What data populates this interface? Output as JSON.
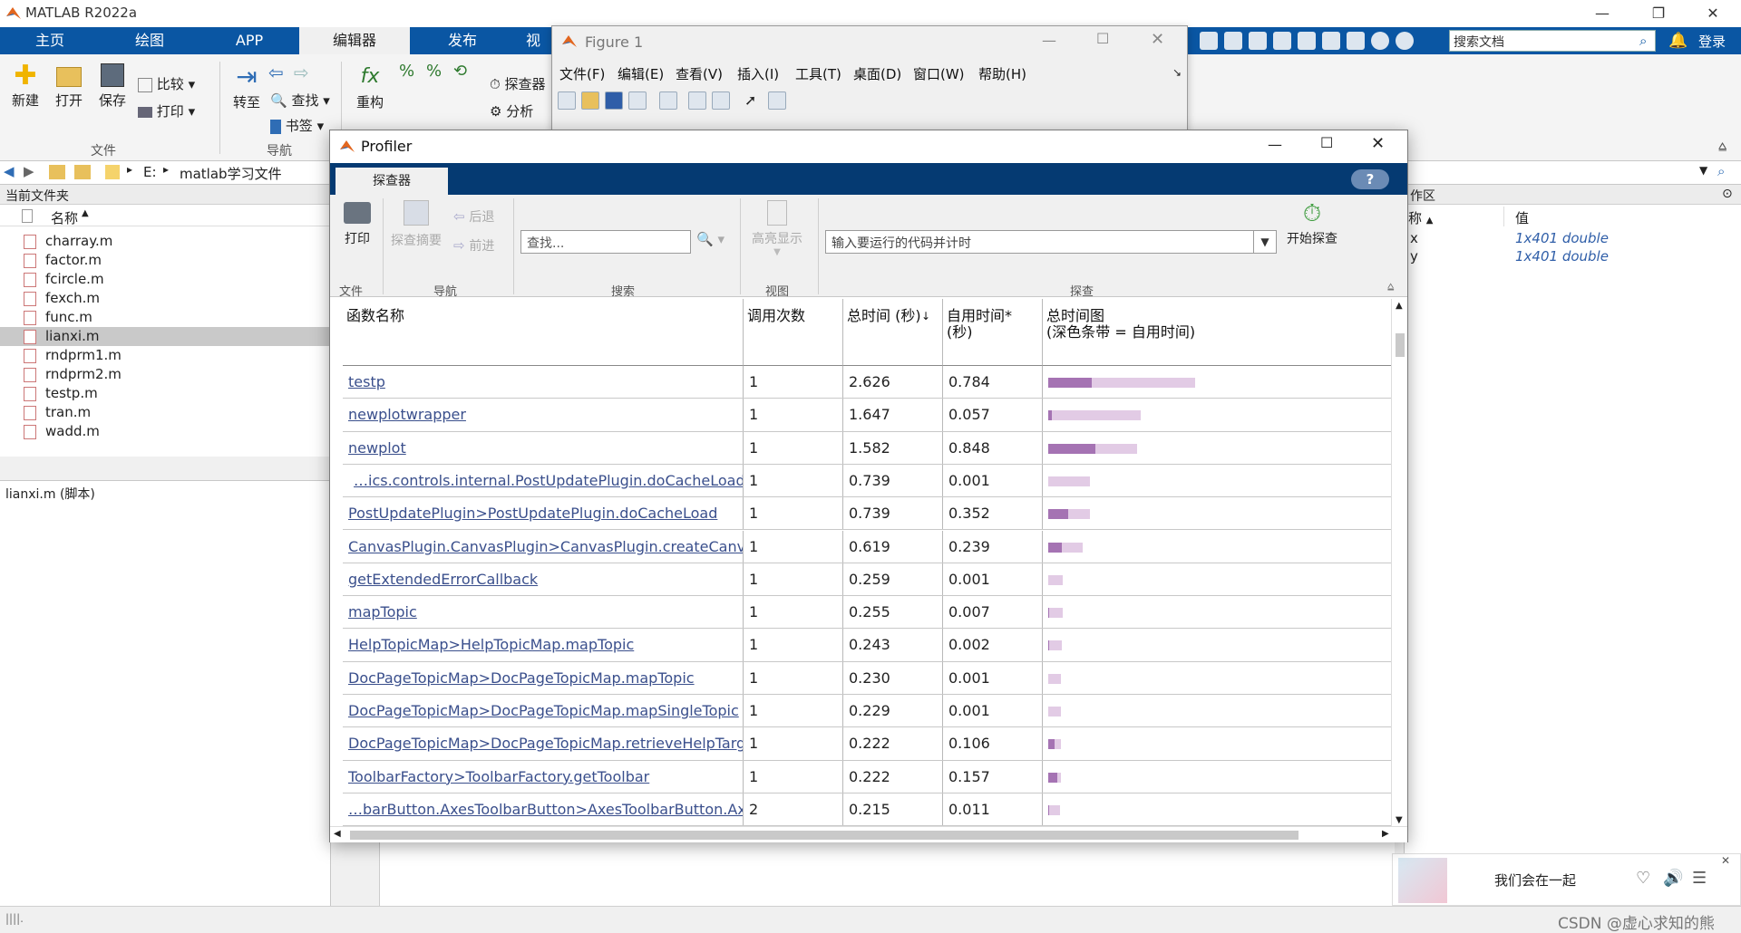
{
  "app": {
    "title": "MATLAB R2022a",
    "ribbon_tabs": [
      "主页",
      "绘图",
      "APP",
      "编辑器",
      "发布",
      "视"
    ],
    "active_tab": "编辑器",
    "search_docs_placeholder": "搜索文档",
    "login_label": "登录"
  },
  "ribbon": {
    "new": "新建",
    "open": "打开",
    "save": "保存",
    "compare": "比较",
    "print": "打印",
    "goto": "转至",
    "find": "查找",
    "bookmark": "书签",
    "refactor": "重构",
    "profiler": "探查器",
    "analyze": "分析",
    "group_file": "文件",
    "group_nav": "导航"
  },
  "path": {
    "drive": "E:",
    "folder": "matlab学习文件"
  },
  "current_folder": {
    "header": "当前文件夹",
    "name_col": "名称",
    "files": [
      "charray.m",
      "factor.m",
      "fcircle.m",
      "fexch.m",
      "func.m",
      "lianxi.m",
      "rndprm1.m",
      "rndprm2.m",
      "testp.m",
      "tran.m",
      "wadd.m"
    ],
    "selected": "lianxi.m",
    "details_label": "lianxi.m  (脚本)"
  },
  "workspace": {
    "header": "作区",
    "name_col": "称",
    "value_col": "值",
    "vars": [
      {
        "name": "x",
        "value": "1x401 double"
      },
      {
        "name": "y",
        "value": "1x401 double"
      }
    ]
  },
  "figure": {
    "title": "Figure 1",
    "menus": [
      "文件(F)",
      "编辑(E)",
      "查看(V)",
      "插入(I)",
      "工具(T)",
      "桌面(D)",
      "窗口(W)",
      "帮助(H)"
    ]
  },
  "profiler": {
    "title": "Profiler",
    "tab": "探查器",
    "help": "?",
    "toolbar": {
      "print": "打印",
      "summary": "探查摘要",
      "back": "后退",
      "forward": "前进",
      "search_placeholder": "查找...",
      "highlight": "高亮显示",
      "code_placeholder": "输入要运行的代码并计时",
      "start": "开始探查",
      "group_file": "文件",
      "group_nav": "导航",
      "group_search": "搜索",
      "group_view": "视图",
      "group_profile": "探查"
    },
    "columns": {
      "name": "函数名称",
      "calls": "调用次数",
      "total": "总时间 (秒)",
      "self_line1": "自用时间*",
      "self_line2": "(秒)",
      "chart_line1": "总时间图",
      "chart_line2": "(深色条带 = 自用时间)"
    },
    "rows": [
      {
        "name": "testp",
        "calls": "1",
        "total": "2.626",
        "self": "0.784"
      },
      {
        "name": "newplotwrapper",
        "calls": "1",
        "total": "1.647",
        "self": "0.057"
      },
      {
        "name": "newplot",
        "calls": "1",
        "total": "1.582",
        "self": "0.848"
      },
      {
        "name": "…ics.controls.internal.PostUpdatePlugin.doCacheLoad(canvasParent)",
        "calls": "1",
        "total": "0.739",
        "self": "0.001",
        "indent": true
      },
      {
        "name": "PostUpdatePlugin>PostUpdatePlugin.doCacheLoad",
        "calls": "1",
        "total": "0.739",
        "self": "0.352"
      },
      {
        "name": "CanvasPlugin.CanvasPlugin>CanvasPlugin.createCanvas",
        "calls": "1",
        "total": "0.619",
        "self": "0.239"
      },
      {
        "name": "getExtendedErrorCallback",
        "calls": "1",
        "total": "0.259",
        "self": "0.001"
      },
      {
        "name": "mapTopic",
        "calls": "1",
        "total": "0.255",
        "self": "0.007"
      },
      {
        "name": "HelpTopicMap>HelpTopicMap.mapTopic",
        "calls": "1",
        "total": "0.243",
        "self": "0.002"
      },
      {
        "name": "DocPageTopicMap>DocPageTopicMap.mapTopic",
        "calls": "1",
        "total": "0.230",
        "self": "0.001"
      },
      {
        "name": "DocPageTopicMap>DocPageTopicMap.mapSingleTopic",
        "calls": "1",
        "total": "0.229",
        "self": "0.001"
      },
      {
        "name": "DocPageTopicMap>DocPageTopicMap.retrieveHelpTargets",
        "calls": "1",
        "total": "0.222",
        "self": "0.106"
      },
      {
        "name": "ToolbarFactory>ToolbarFactory.getToolbar",
        "calls": "1",
        "total": "0.222",
        "self": "0.157"
      },
      {
        "name": "…barButton.AxesToolbarButton>AxesToolbarButton.AxesToolbarButton",
        "calls": "2",
        "total": "0.215",
        "self": "0.011"
      }
    ],
    "colors": {
      "dark_bar": "#a573b3",
      "light_bar": "#e2cbe5",
      "tabbar": "#053a72"
    }
  },
  "music": {
    "text": "我们会在一起"
  },
  "watermark": "CSDN @虚心求知的熊"
}
